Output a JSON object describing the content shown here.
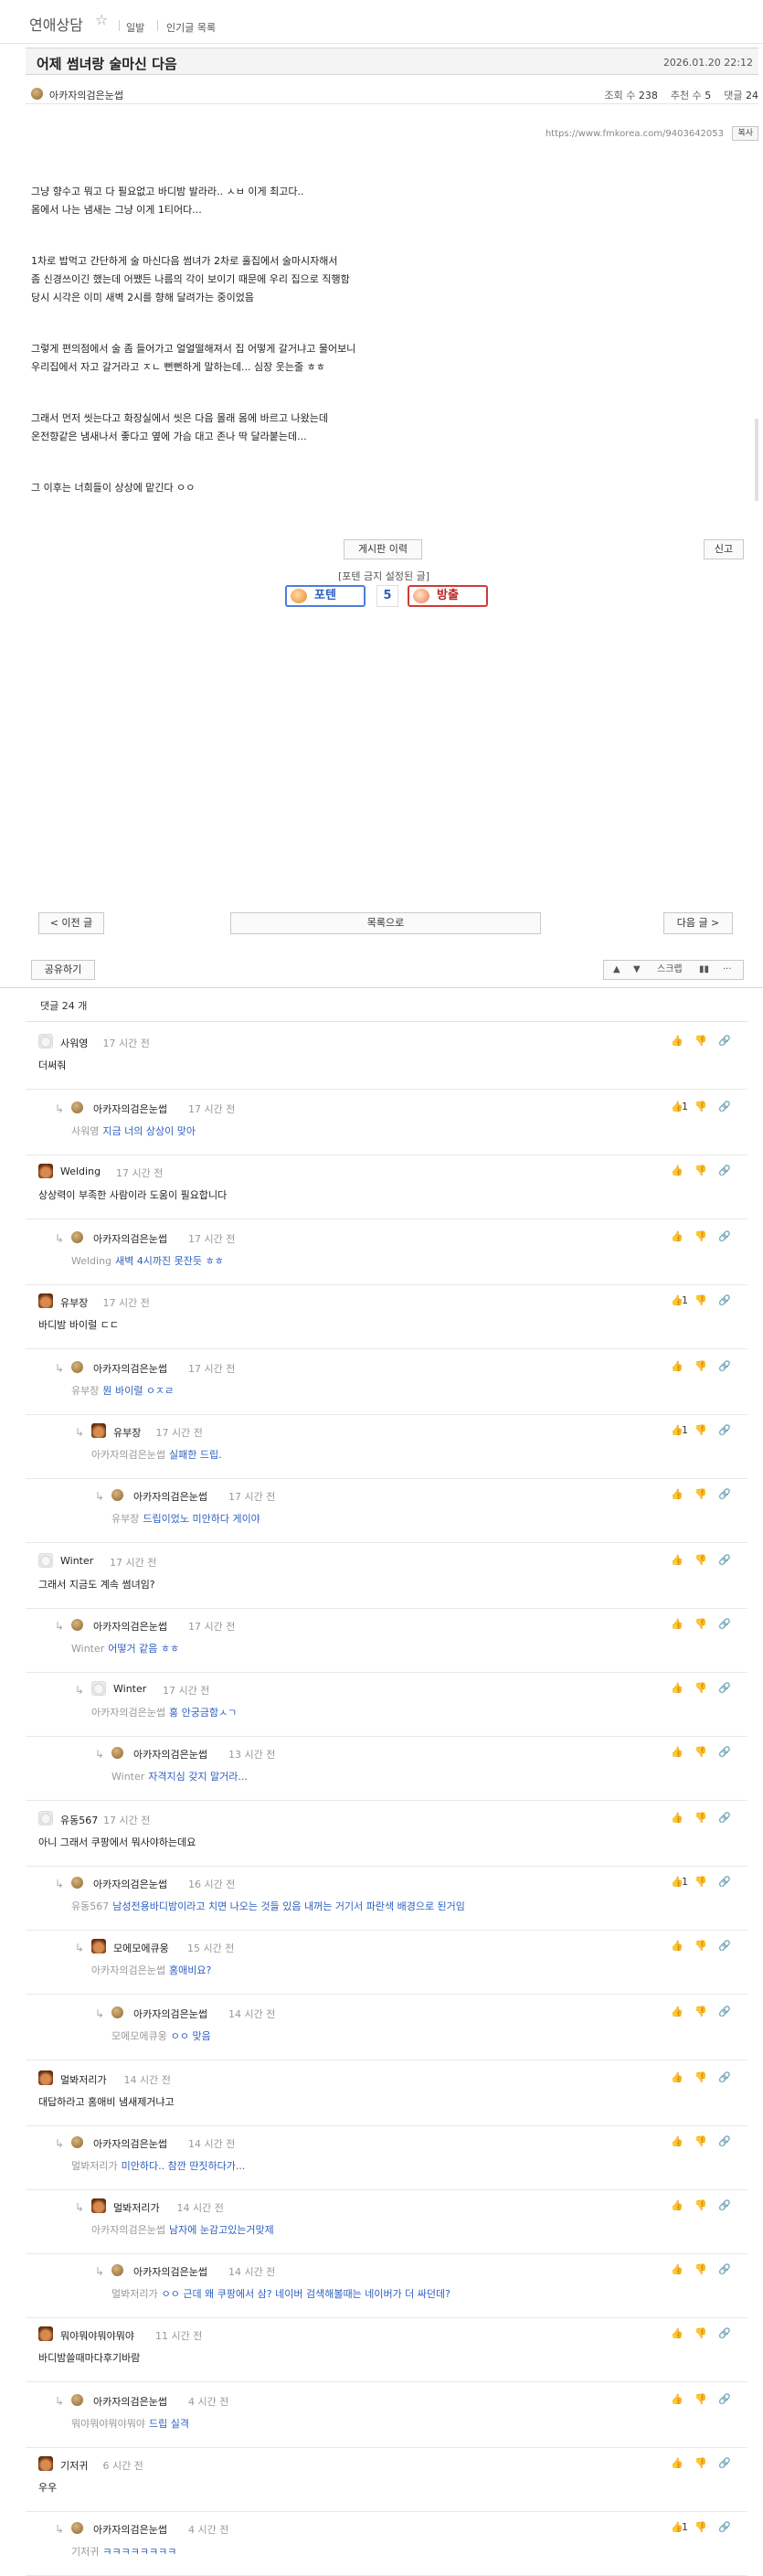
{
  "board": {
    "title": "연애상담",
    "star": "☆",
    "links": [
      "일발",
      "인기글 목록"
    ]
  },
  "post": {
    "title": "어제 썸녀랑 술마신 다음",
    "date": "2026.01.20 22:12",
    "author": "아카자의검은눈썹",
    "views_label": "조회 수",
    "views": "238",
    "votes_label": "추천 수",
    "votes": "5",
    "comments_label": "댓글",
    "comments": "24",
    "url": "https://www.fmkorea.com/9403642053",
    "copy_label": "복사",
    "paragraphs": [
      "그냥 향수고 뭐고 다 필요없고 바디밤 발라라.. ㅅㅂ 이게 최고다..\n몸에서 나는 냄새는 그냥 이게 1티어다...",
      "1차로 밥먹고 간단하게 술 마신다음 썸녀가 2차로 홀집에서 술마시자해서\n좀 신경쓰이긴 했는데 어쨌든 나름의 각이 보이기 때문에 우리 집으로 직행함\n당시 시각은 이미 새벽 2시를 향해 달려가는 중이었음",
      "그렇게 편의점에서 술 좀 들어가고 얼얼떨해져서 집 어떻게 갈거냐고 물어보니\n우리집에서 자고 갈거라고 ㅈㄴ 뻔뻔하게 말하는데... 심장 웃는줄 ㅎㅎ",
      "그래서 먼저 씻는다고 화장실에서 씻은 다음 몰래 몸에 바르고 나왔는데\n온전향같은 냄새나서 좋다고 옆에 가슴 대고 존나 딱 달라붙는데...",
      "그 이후는 너희들이 상상에 맡긴다 ㅇㅇ"
    ],
    "history_label": "게시판 이력",
    "report_label": "신고",
    "forbidden_note": "[포텐 금지 설정된 글]",
    "potent_label": "포텐",
    "vote_count": "5",
    "bang_label": "방출"
  },
  "nav": {
    "prev_label": "< 이전 글",
    "list_label": "목록으로",
    "next_label": "다음 글 >"
  },
  "toolbar": {
    "share_label": "공유하기",
    "up_icon": "▲",
    "down_icon": "▼",
    "scrap_label": "스크랩",
    "chart_icon": "▮▮",
    "more_icon": "···"
  },
  "comment_header": {
    "label": "댓글",
    "count": "24",
    "unit": "개"
  },
  "comments": [
    {
      "name": "사워영",
      "time": "17 시간 전",
      "avatar": "av-dog",
      "mention": "",
      "text": "더써줘",
      "likes": "",
      "depth": 0
    },
    {
      "name": "아카자의검은눈썹",
      "time": "17 시간 전",
      "avatar": "av-dot",
      "mention": "사워영",
      "text": "지금 너의 상상이 맞아",
      "likes": "1",
      "depth": 1
    },
    {
      "name": "Welding",
      "time": "17 시간 전",
      "avatar": "av-bear",
      "mention": "",
      "text": "상상력이 부족한 사람이라 도움이 필요합니다",
      "likes": "",
      "depth": 0
    },
    {
      "name": "아카자의검은눈썹",
      "time": "17 시간 전",
      "avatar": "av-dot",
      "mention": "Welding",
      "text": "새벽 4시까진 못잔듯 ㅎㅎ",
      "likes": "",
      "depth": 1
    },
    {
      "name": "유부장",
      "time": "17 시간 전",
      "avatar": "av-bear",
      "mention": "",
      "text": "바디밤 바이럴 ㄷㄷ",
      "likes": "1",
      "depth": 0
    },
    {
      "name": "아카자의검은눈썹",
      "time": "17 시간 전",
      "avatar": "av-dot",
      "mention": "유부장",
      "text": "뭔 바이럴 ㅇㅈㄹ",
      "likes": "",
      "depth": 1
    },
    {
      "name": "유부장",
      "time": "17 시간 전",
      "avatar": "av-bear",
      "mention": "아카자의검은눈썹",
      "text": "실패한 드립.",
      "likes": "1",
      "depth": 2
    },
    {
      "name": "아카자의검은눈썹",
      "time": "17 시간 전",
      "avatar": "av-dot",
      "mention": "유부장",
      "text": "드립이었노 미안하다 게이야",
      "likes": "",
      "depth": 3
    },
    {
      "name": "Winter",
      "time": "17 시간 전",
      "avatar": "av-dog",
      "mention": "",
      "text": "그래서 지금도 계속 썸녀임?",
      "likes": "",
      "depth": 0
    },
    {
      "name": "아카자의검은눈썹",
      "time": "17 시간 전",
      "avatar": "av-dot",
      "mention": "Winter",
      "text": "어떻거 같음 ㅎㅎ",
      "likes": "",
      "depth": 1
    },
    {
      "name": "Winter",
      "time": "17 시간 전",
      "avatar": "av-dog",
      "mention": "아카자의검은눈썹",
      "text": "홍 안궁금함ㅅㄱ",
      "likes": "",
      "depth": 2
    },
    {
      "name": "아카자의검은눈썹",
      "time": "13 시간 전",
      "avatar": "av-dot",
      "mention": "Winter",
      "text": "자격지심 갖지 말거라...",
      "likes": "",
      "depth": 3
    },
    {
      "name": "유동567",
      "time": "17 시간 전",
      "avatar": "av-dog",
      "mention": "",
      "text": "아니 그래서 쿠팡에서 뭐사야하는데요",
      "likes": "",
      "depth": 0
    },
    {
      "name": "아카자의검은눈썹",
      "time": "16 시간 전",
      "avatar": "av-dot",
      "mention": "유동567",
      "text": "남성전용바디밤이라고 치면 나오는 것들 있음 내꺼는 거기서 파란색 배경으로 된거임",
      "likes": "1",
      "depth": 1
    },
    {
      "name": "모에모에큐웅",
      "time": "15 시간 전",
      "avatar": "av-bear",
      "mention": "아카자의검은눈썹",
      "text": "홈애비요?",
      "likes": "",
      "depth": 2
    },
    {
      "name": "아카자의검은눈썹",
      "time": "14 시간 전",
      "avatar": "av-dot",
      "mention": "모에모에큐웅",
      "text": "ㅇㅇ 맞음",
      "likes": "",
      "depth": 3
    },
    {
      "name": "멀봐저리가",
      "time": "14 시간 전",
      "avatar": "av-bear",
      "mention": "",
      "text": "대답하라고 홈애비 냄새제거냐고",
      "likes": "",
      "depth": 0
    },
    {
      "name": "아카자의검은눈썹",
      "time": "14 시간 전",
      "avatar": "av-dot",
      "mention": "멀봐저리가",
      "text": "미안하다.. 참깐 딴짓하다가...",
      "likes": "",
      "depth": 1
    },
    {
      "name": "멀봐저리가",
      "time": "14 시간 전",
      "avatar": "av-bear",
      "mention": "아카자의검은눈썹",
      "text": "남자에 눈감고있는거맞제",
      "likes": "",
      "depth": 2
    },
    {
      "name": "아카자의검은눈썹",
      "time": "14 시간 전",
      "avatar": "av-dot",
      "mention": "멀봐저리가",
      "text": "ㅇㅇ 근데 왜 쿠팡에서 삼? 네이버 검색해볼때는 네이버가 더 싸던데?",
      "likes": "",
      "depth": 3
    },
    {
      "name": "뭐야뭐야뭐야뭐야",
      "time": "11 시간 전",
      "avatar": "av-bear",
      "mention": "",
      "text": "바디밤쓸때마다후기바람",
      "likes": "",
      "depth": 0
    },
    {
      "name": "아카자의검은눈썹",
      "time": "4 시간 전",
      "avatar": "av-dot",
      "mention": "뭐야뭐야뭐야뭐야",
      "text": "드립 실격",
      "likes": "",
      "depth": 1
    },
    {
      "name": "기저귀",
      "time": "6 시간 전",
      "avatar": "av-bear",
      "mention": "",
      "text": "우우",
      "likes": "",
      "depth": 0
    },
    {
      "name": "아카자의검은눈썹",
      "time": "4 시간 전",
      "avatar": "av-dot",
      "mention": "기저귀",
      "text": "ㅋㅋㅋㅋㅋㅋㅋㅋ",
      "likes": "1",
      "depth": 1
    }
  ],
  "icons": {
    "reply_arrow": "↳",
    "like": "👍",
    "dislike": "👎",
    "link": "🔗"
  }
}
